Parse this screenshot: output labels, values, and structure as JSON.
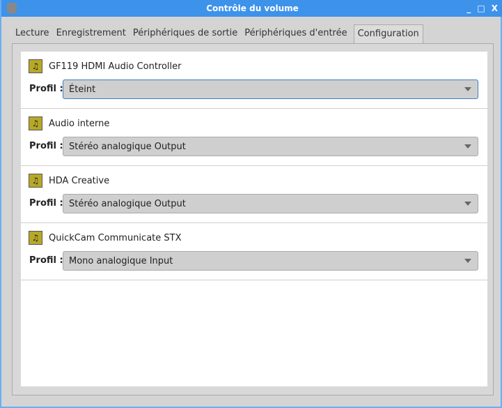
{
  "window": {
    "title": "Contrôle du volume"
  },
  "tabs": [
    {
      "label": "Lecture"
    },
    {
      "label": "Enregistrement"
    },
    {
      "label": "Périphériques de sortie"
    },
    {
      "label": "Périphériques d'entrée"
    },
    {
      "label": "Configuration",
      "active": true
    }
  ],
  "profile_label": "Profil :",
  "cards": [
    {
      "name": "GF119 HDMI Audio Controller",
      "profile": "Éteint"
    },
    {
      "name": "Audio interne",
      "profile": "Stéréo analogique Output"
    },
    {
      "name": "HDA Creative",
      "profile": "Stéréo analogique Output"
    },
    {
      "name": "QuickCam Communicate STX",
      "profile": "Mono analogique Input"
    }
  ]
}
